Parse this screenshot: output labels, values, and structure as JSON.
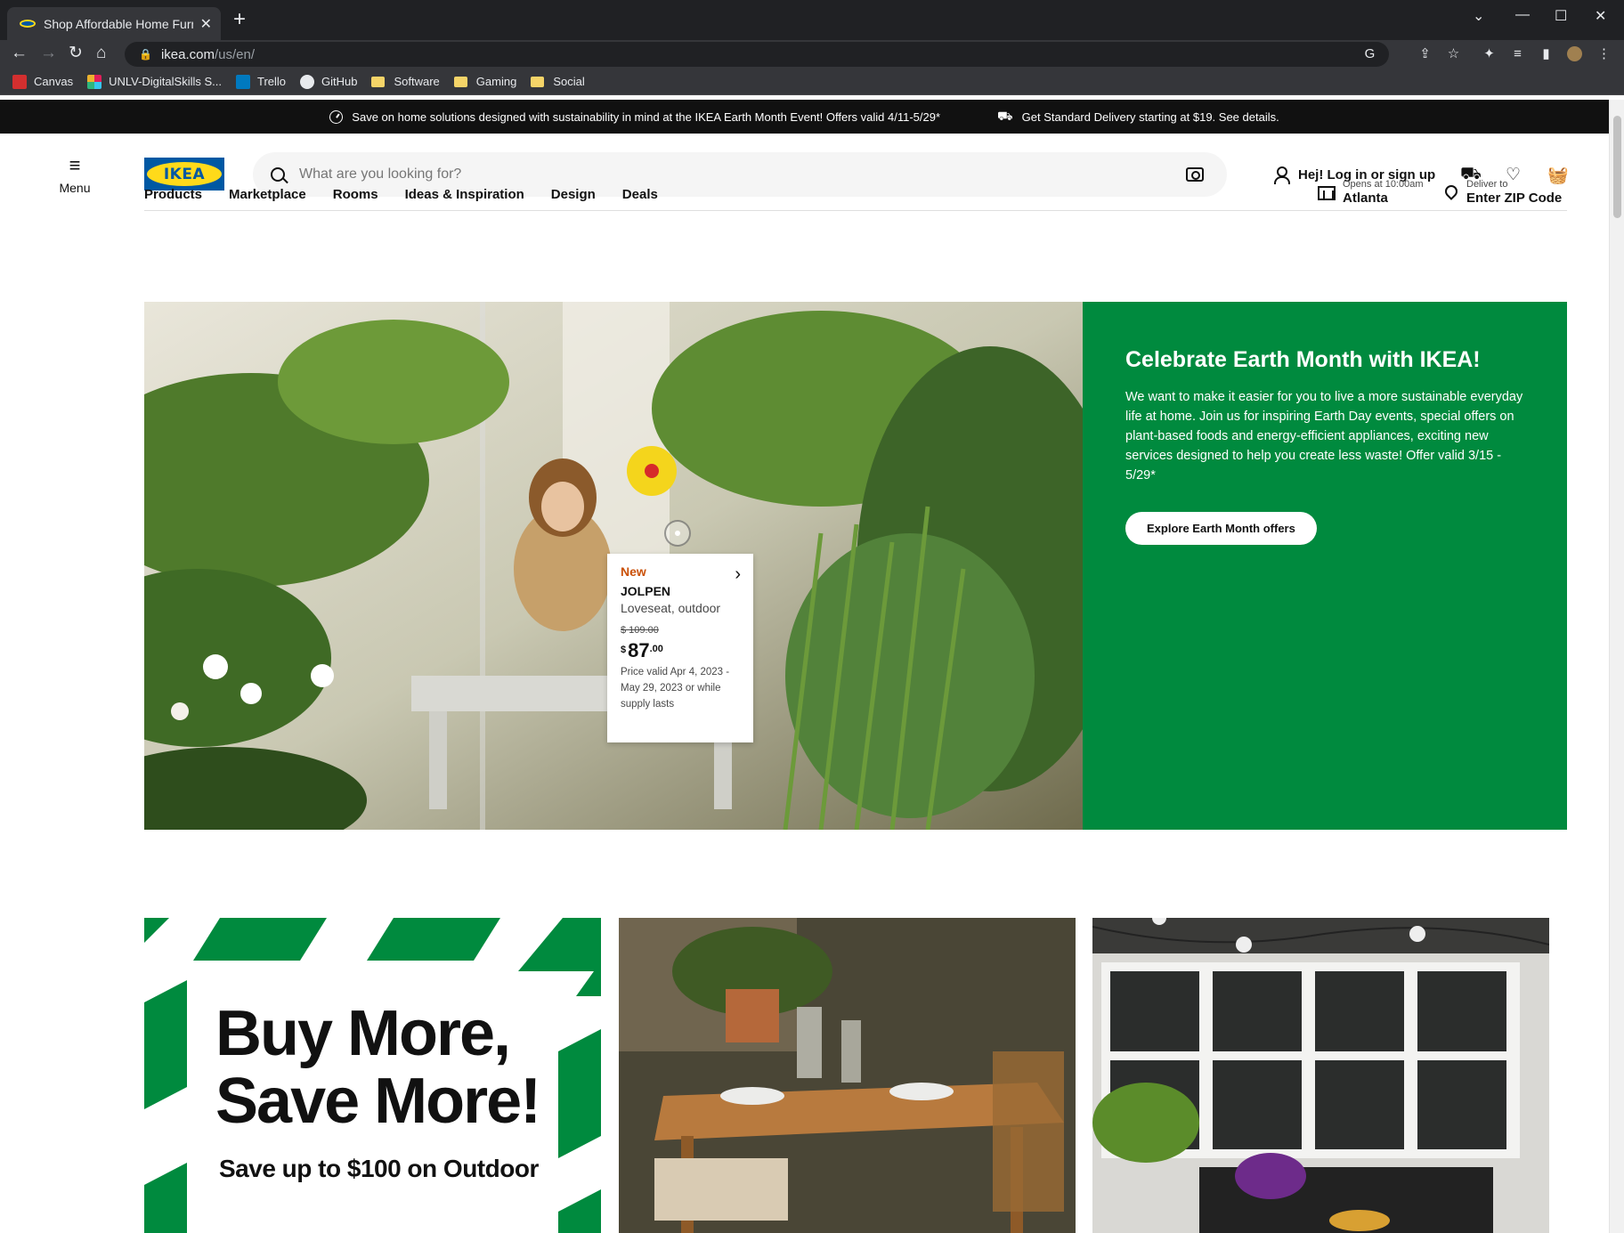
{
  "browser": {
    "tab_title": "Shop Affordable Home Furnishin",
    "url_host": "ikea.com",
    "url_path": "/us/en/",
    "bookmarks": [
      "Canvas",
      "UNLV-DigitalSkills S...",
      "Trello",
      "GitHub",
      "Software",
      "Gaming",
      "Social"
    ]
  },
  "promo_bar": {
    "left": "Save on home solutions designed with sustainability in mind at the IKEA Earth Month Event! Offers valid 4/11-5/29*",
    "right": "Get Standard Delivery starting at $19. See details."
  },
  "header": {
    "menu_label": "Menu",
    "logo_text": "IKEA",
    "search_placeholder": "What are you looking for?",
    "account_label": "Hej! Log in or sign up",
    "nav": [
      "Products",
      "Marketplace",
      "Rooms",
      "Ideas & Inspiration",
      "Design",
      "Deals"
    ],
    "store_hours": "Opens at 10:00am",
    "store_name": "Atlanta",
    "deliver_label": "Deliver to",
    "zip_label": "Enter ZIP Code"
  },
  "hero": {
    "title": "Celebrate Earth Month with IKEA!",
    "body": "We want to make it easier for you to live a more sustainable everyday life at home. Join us for inspiring Earth Day events, special offers on plant-based foods and energy-efficient appliances, exciting new services designed to help you create less waste! Offer valid 3/15 - 5/29*",
    "button": "Explore Earth Month offers",
    "accent_color": "#008a3e"
  },
  "product_card": {
    "badge": "New",
    "name": "JOLPEN",
    "description": "Loveseat, outdoor",
    "old_price": "$ 109.00",
    "currency": "$",
    "price_int": "87",
    "price_dec": ".00",
    "validity": "Price valid Apr 4, 2023 - May 29, 2023 or while supply lasts"
  },
  "tiles": {
    "sale_heading_1": "Buy More,",
    "sale_heading_2": "Save More!",
    "sale_sub": "Save up to $100 on Outdoor"
  }
}
